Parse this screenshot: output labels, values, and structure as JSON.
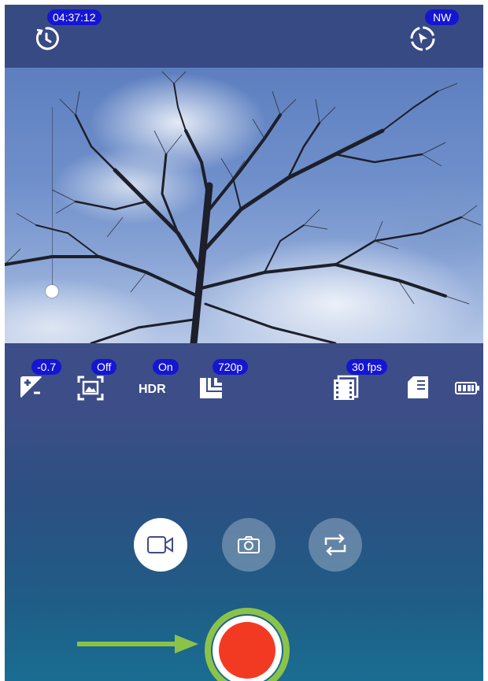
{
  "top_bar": {
    "timer_value": "04:37:12",
    "compass_direction": "NW",
    "icons": [
      "timer-icon",
      "compass-icon"
    ]
  },
  "settings_bar": {
    "exposure_value": "-0.7",
    "focus_mode_value": "Off",
    "hdr_label": "HDR",
    "hdr_value": "On",
    "resolution_value": "720p",
    "frame_rate_value": "30 fps",
    "icons": [
      "exposure-icon",
      "focus-frame-icon",
      "resolution-icon",
      "film-icon",
      "sd-card-icon",
      "battery-icon"
    ]
  },
  "exposure_slider": {
    "level": 0.15
  },
  "modes": [
    {
      "name": "video",
      "icon": "video-camera-icon",
      "selected": true
    },
    {
      "name": "photo",
      "icon": "camera-icon",
      "selected": false
    },
    {
      "name": "switch-camera",
      "icon": "switch-camera-icon",
      "selected": false
    }
  ],
  "colors": {
    "badge": "#1515d4",
    "shutter": "#f23a23",
    "highlight_ring": "#8bc34a",
    "arrow": "#8bc34a"
  }
}
